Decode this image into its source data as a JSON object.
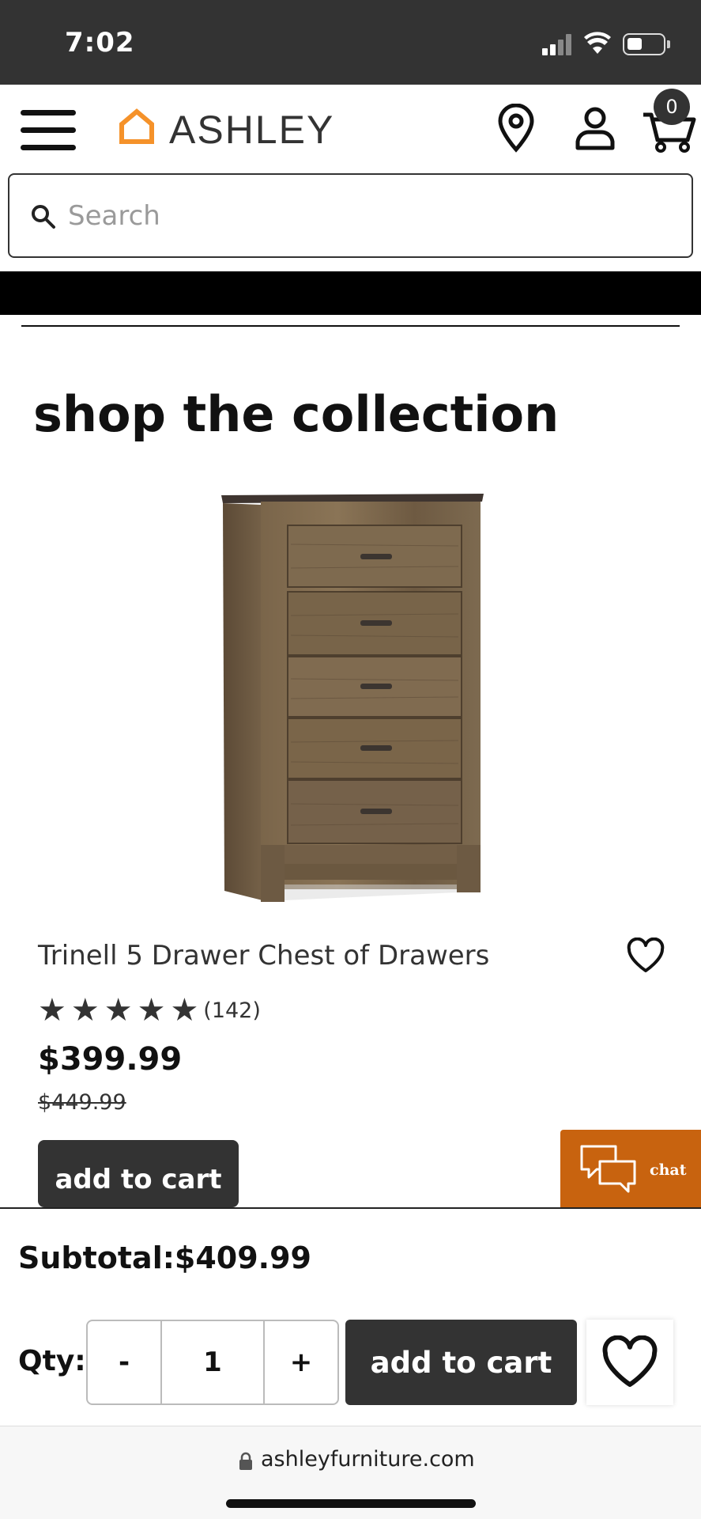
{
  "status_bar": {
    "time": "7:02"
  },
  "header": {
    "brand": "ASHLEY",
    "cart_count": "0"
  },
  "search": {
    "placeholder": "Search"
  },
  "section": {
    "title": "shop the collection"
  },
  "product": {
    "name": "Trinell 5 Drawer Chest of Drawers",
    "rating": 5,
    "review_count": "(142)",
    "price": "$399.99",
    "was_price": "$449.99",
    "add_to_cart_label": "add to cart"
  },
  "chat": {
    "label": "chat"
  },
  "sticky_bar": {
    "subtotal": "Subtotal:$409.99",
    "qty_label": "Qty:",
    "minus": "-",
    "quantity": "1",
    "plus": "+",
    "add_to_cart_label": "add to cart"
  },
  "browser": {
    "url": "ashleyfurniture.com"
  },
  "colors": {
    "status_bar": "#333333",
    "brand_orange": "#f5922a",
    "chat_orange": "#c8630f",
    "button_dark": "#333333"
  }
}
